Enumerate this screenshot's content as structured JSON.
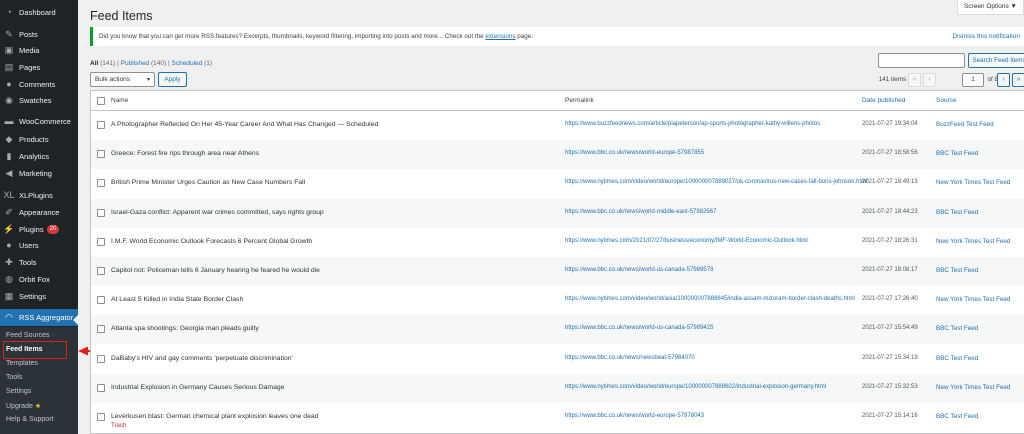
{
  "sidebar": {
    "items": [
      {
        "label": "Dashboard",
        "icon": "dashboard-icon",
        "glyph": "◔"
      },
      {
        "label": "Posts",
        "icon": "pin-icon",
        "glyph": "✎"
      },
      {
        "label": "Media",
        "icon": "media-icon",
        "glyph": "▣"
      },
      {
        "label": "Pages",
        "icon": "pages-icon",
        "glyph": "▤"
      },
      {
        "label": "Comments",
        "icon": "comments-icon",
        "glyph": "●"
      },
      {
        "label": "Swatches",
        "icon": "swatches-icon",
        "glyph": "◉"
      },
      {
        "label": "WooCommerce",
        "icon": "woocommerce-icon",
        "glyph": "▬"
      },
      {
        "label": "Products",
        "icon": "products-icon",
        "glyph": "◆"
      },
      {
        "label": "Analytics",
        "icon": "analytics-icon",
        "glyph": "▮"
      },
      {
        "label": "Marketing",
        "icon": "marketing-icon",
        "glyph": "◀"
      },
      {
        "label": "XLPlugins",
        "icon": "xlplugins-icon",
        "glyph": "XL"
      },
      {
        "label": "Appearance",
        "icon": "appearance-icon",
        "glyph": "✐"
      },
      {
        "label": "Plugins",
        "icon": "plugins-icon",
        "glyph": "⚡",
        "badge": "20"
      },
      {
        "label": "Users",
        "icon": "users-icon",
        "glyph": "●"
      },
      {
        "label": "Tools",
        "icon": "tools-icon",
        "glyph": "✚"
      },
      {
        "label": "Orbit Fox",
        "icon": "orbit-fox-icon",
        "glyph": "◍"
      },
      {
        "label": "Settings",
        "icon": "settings-icon",
        "glyph": "▦"
      },
      {
        "label": "RSS Aggregator",
        "icon": "rss-icon",
        "glyph": "◠"
      }
    ],
    "submenu": [
      "Feed Sources",
      "Feed Items",
      "Templates",
      "Tools",
      "Settings",
      "Upgrade",
      "Help & Support"
    ]
  },
  "header": {
    "screen_options": "Screen Options ▼",
    "title": "Feed Items"
  },
  "notice": {
    "text_before": "Did you know that you can get more RSS features? Excerpts, thumbnails, keyword filtering, importing into posts and more... Check out the ",
    "link": "extensions",
    "text_after": " page.",
    "dismiss": "Dismiss this notification"
  },
  "views": {
    "all": "All",
    "all_count": "(141)",
    "sep1": "|",
    "published": "Published",
    "published_count": "(140)",
    "sep2": "|",
    "scheduled": "Scheduled",
    "scheduled_count": "(1)"
  },
  "search": {
    "placeholder": "",
    "button": "Search Feed Items"
  },
  "bulk": {
    "selected": "Bulk actions",
    "apply": "Apply"
  },
  "pagination": {
    "count": "141 items",
    "first": "«",
    "prev": "‹",
    "current": "1",
    "of": "of 8",
    "next": "›",
    "last": "»"
  },
  "table": {
    "columns": {
      "name": "Name",
      "permalink": "Permalink",
      "date": "Date published",
      "source": "Source"
    },
    "rows": [
      {
        "name": "A Photographer Reflected On Her 45-Year Career And What Has Changed — Scheduled",
        "permalink": "https://www.buzzfeednews.com/article/piapeterson/ap-sports-photographer-kathy-willens-photos",
        "date": "2021-07-27 19:34:04",
        "source": "BuzzFeed Test Feed"
      },
      {
        "name": "Greece: Forest fire rips through area near Athens",
        "permalink": "https://www.bbc.co.uk/news/world-europe-57987855",
        "date": "2021-07-27 18:58:56",
        "source": "BBC Test Feed"
      },
      {
        "name": "British Prime Minister Urges Caution as New Case Numbers Fall",
        "permalink": "https://www.nytimes.com/video/world/europe/100000007889027/uk-coronavirus-new-cases-fall-boris-johnson.html",
        "date": "2021-07-27 18:49:13",
        "source": "New York Times Test Feed"
      },
      {
        "name": "Israel-Gaza conflict: Apparent war crimes committed, says rights group",
        "permalink": "https://www.bbc.co.uk/news/world-middle-east-57982567",
        "date": "2021-07-27 18:44:23",
        "source": "BBC Test Feed"
      },
      {
        "name": "I.M.F. World Economic Outlook Forecasts 6 Percent Global Growth",
        "permalink": "https://www.nytimes.com/2021/07/27/business/economy/IMF-World-Economic-Outlook.html",
        "date": "2021-07-27 18:26:31",
        "source": "New York Times Test Feed"
      },
      {
        "name": "Capitol riot: Policeman tells 6 January hearing he feared he would die",
        "permalink": "https://www.bbc.co.uk/news/world-us-canada-57989578",
        "date": "2021-07-27 18:08:17",
        "source": "BBC Test Feed"
      },
      {
        "name": "At Least 5 Killed in India State Border Clash",
        "permalink": "https://www.nytimes.com/video/world/asia/100000007888845/india-assam-mizoram-border-clash-deaths.html",
        "date": "2021-07-27 17:26:40",
        "source": "New York Times Test Feed"
      },
      {
        "name": "Atlanta spa shootings: Georgia man pleads guilty",
        "permalink": "https://www.bbc.co.uk/news/world-us-canada-57989425",
        "date": "2021-07-27 15:54:49",
        "source": "BBC Test Feed"
      },
      {
        "name": "DaBaby's HIV and gay comments 'perpetuate discrimination'",
        "permalink": "https://www.bbc.co.uk/news/newsbeat-57984070",
        "date": "2021-07-27 15:34:19",
        "source": "BBC Test Feed"
      },
      {
        "name": "Industrial Explosion in Germany Causes Serious Damage",
        "permalink": "https://www.nytimes.com/video/world/europe/100000007888602/industrial-explosion-germany.html",
        "date": "2021-07-27 15:32:53",
        "source": "New York Times Test Feed"
      },
      {
        "name": "Leverkusen blast: German chemical plant explosion leaves one dead",
        "permalink": "https://www.bbc.co.uk/news/world-europe-57978043",
        "date": "2021-07-27 15:14:16",
        "source": "BBC Test Feed",
        "trash": "Trash"
      }
    ]
  },
  "colors": {
    "accent": "#2271b1",
    "sidebar": "#1d2327",
    "highlight": "#e02020"
  }
}
